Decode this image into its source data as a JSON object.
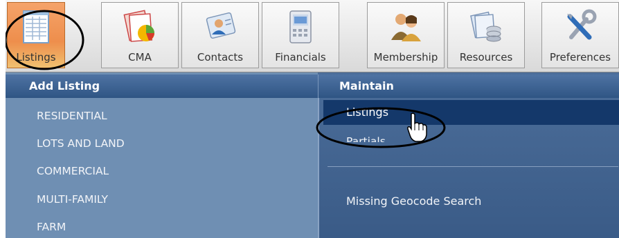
{
  "toolbar": {
    "tabs": [
      {
        "label": "Listings",
        "icon": "listings-icon"
      },
      {
        "label": "CMA",
        "icon": "cma-icon"
      },
      {
        "label": "Contacts",
        "icon": "contacts-icon"
      },
      {
        "label": "Financials",
        "icon": "financials-icon"
      },
      {
        "label": "Membership",
        "icon": "membership-icon"
      },
      {
        "label": "Resources",
        "icon": "resources-icon"
      },
      {
        "label": "Preferences",
        "icon": "preferences-icon"
      }
    ],
    "active_tab": "Listings"
  },
  "add_listing": {
    "title": "Add Listing",
    "items": [
      "RESIDENTIAL",
      "LOTS AND LAND",
      "COMMERCIAL",
      "MULTI-FAMILY",
      "FARM"
    ]
  },
  "maintain": {
    "title": "Maintain",
    "items": [
      "Listings",
      "Partials",
      "Missing Geocode Search"
    ],
    "selected": "Listings"
  },
  "colors": {
    "panel_header": "#2f5584",
    "selected_row": "#14386a",
    "left_panel": "#6f8fb3",
    "active_tab": "#ee8e4c"
  }
}
